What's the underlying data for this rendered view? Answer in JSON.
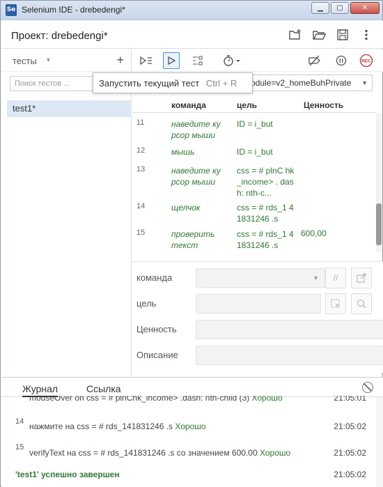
{
  "window": {
    "app_icon": "Se",
    "title": "Selenium IDE - drebedengi*",
    "controls": [
      "minimize",
      "maximize",
      "close"
    ]
  },
  "project": {
    "label": "Проект:",
    "name": "drebedengi*",
    "icons": [
      "new-folder-icon",
      "open-folder-icon",
      "save-icon",
      "more-icon"
    ]
  },
  "tests_panel": {
    "dropdown_label": "тесты",
    "add": "+",
    "search_placeholder": "Поиск тестов ...",
    "items": [
      {
        "label": "test1*",
        "selected": true
      }
    ]
  },
  "toolbar": {
    "buttons": [
      "run-all-icon",
      "run-current-icon",
      "step-icon",
      "speed-icon",
      "disable-breakpoints-icon",
      "pause-icon",
      "record-icon"
    ],
    "record_label": "REC",
    "base_url": "odule=v2_homeBuhPrivate"
  },
  "tooltip": {
    "text": "Запустить текущий тест",
    "shortcut": "Ctrl + R"
  },
  "table": {
    "headers": {
      "command": "команда",
      "target": "цель",
      "value": "Ценность"
    },
    "rows": [
      {
        "num": "11",
        "command": "наведите ку рсор мыши",
        "target": "ID = i_but",
        "value": ""
      },
      {
        "num": "12",
        "command": "мышь",
        "target": "ID = i_but",
        "value": ""
      },
      {
        "num": "13",
        "command": "наведите ку рсор мыши",
        "target": "css = # plnC hk_income> . dash: nth-c...",
        "value": ""
      },
      {
        "num": "14",
        "command": "щелчок",
        "target": "css = # rds_1 41831246 .s",
        "value": ""
      },
      {
        "num": "15",
        "command": "проверить текст",
        "target": "css = # rds_1 41831246 .s",
        "value": "600,00"
      }
    ]
  },
  "editor": {
    "command_label": "команда",
    "target_label": "цель",
    "value_label": "Ценность",
    "description_label": "Описание"
  },
  "log": {
    "tabs": [
      "Журнал",
      "Ссылка"
    ],
    "lines": [
      {
        "num": "",
        "text": "mouseOver on css = # plnChk_income> .dash: nth-child (3)",
        "status": "Хорошо",
        "time": "21:05:01"
      },
      {
        "num": "14",
        "text": "нажмите на css = # rds_141831246 .s",
        "status": "Хорошо",
        "time": "21:05:02"
      },
      {
        "num": "15",
        "text": "verifyText на css = # rds_141831246 .s со значением 600.00",
        "status": "Хорошо",
        "time": "21:05:02"
      }
    ],
    "summary": {
      "text": "'test1' успешно завершен",
      "time": "21:05:02"
    }
  }
}
